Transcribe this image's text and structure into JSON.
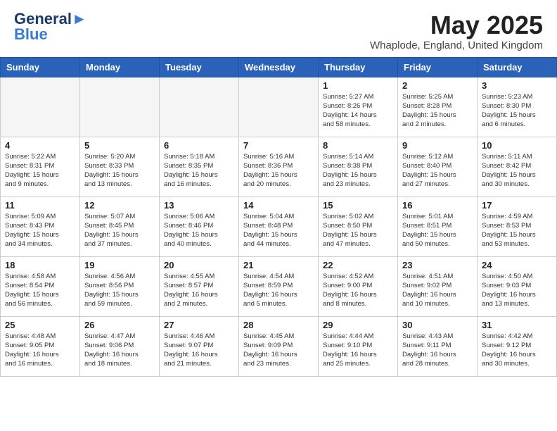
{
  "logo": {
    "general": "General",
    "blue": "Blue"
  },
  "header": {
    "title": "May 2025",
    "subtitle": "Whaplode, England, United Kingdom"
  },
  "days_of_week": [
    "Sunday",
    "Monday",
    "Tuesday",
    "Wednesday",
    "Thursday",
    "Friday",
    "Saturday"
  ],
  "weeks": [
    [
      {
        "day": "",
        "info": ""
      },
      {
        "day": "",
        "info": ""
      },
      {
        "day": "",
        "info": ""
      },
      {
        "day": "",
        "info": ""
      },
      {
        "day": "1",
        "info": "Sunrise: 5:27 AM\nSunset: 8:26 PM\nDaylight: 14 hours\nand 58 minutes."
      },
      {
        "day": "2",
        "info": "Sunrise: 5:25 AM\nSunset: 8:28 PM\nDaylight: 15 hours\nand 2 minutes."
      },
      {
        "day": "3",
        "info": "Sunrise: 5:23 AM\nSunset: 8:30 PM\nDaylight: 15 hours\nand 6 minutes."
      }
    ],
    [
      {
        "day": "4",
        "info": "Sunrise: 5:22 AM\nSunset: 8:31 PM\nDaylight: 15 hours\nand 9 minutes."
      },
      {
        "day": "5",
        "info": "Sunrise: 5:20 AM\nSunset: 8:33 PM\nDaylight: 15 hours\nand 13 minutes."
      },
      {
        "day": "6",
        "info": "Sunrise: 5:18 AM\nSunset: 8:35 PM\nDaylight: 15 hours\nand 16 minutes."
      },
      {
        "day": "7",
        "info": "Sunrise: 5:16 AM\nSunset: 8:36 PM\nDaylight: 15 hours\nand 20 minutes."
      },
      {
        "day": "8",
        "info": "Sunrise: 5:14 AM\nSunset: 8:38 PM\nDaylight: 15 hours\nand 23 minutes."
      },
      {
        "day": "9",
        "info": "Sunrise: 5:12 AM\nSunset: 8:40 PM\nDaylight: 15 hours\nand 27 minutes."
      },
      {
        "day": "10",
        "info": "Sunrise: 5:11 AM\nSunset: 8:42 PM\nDaylight: 15 hours\nand 30 minutes."
      }
    ],
    [
      {
        "day": "11",
        "info": "Sunrise: 5:09 AM\nSunset: 8:43 PM\nDaylight: 15 hours\nand 34 minutes."
      },
      {
        "day": "12",
        "info": "Sunrise: 5:07 AM\nSunset: 8:45 PM\nDaylight: 15 hours\nand 37 minutes."
      },
      {
        "day": "13",
        "info": "Sunrise: 5:06 AM\nSunset: 8:46 PM\nDaylight: 15 hours\nand 40 minutes."
      },
      {
        "day": "14",
        "info": "Sunrise: 5:04 AM\nSunset: 8:48 PM\nDaylight: 15 hours\nand 44 minutes."
      },
      {
        "day": "15",
        "info": "Sunrise: 5:02 AM\nSunset: 8:50 PM\nDaylight: 15 hours\nand 47 minutes."
      },
      {
        "day": "16",
        "info": "Sunrise: 5:01 AM\nSunset: 8:51 PM\nDaylight: 15 hours\nand 50 minutes."
      },
      {
        "day": "17",
        "info": "Sunrise: 4:59 AM\nSunset: 8:53 PM\nDaylight: 15 hours\nand 53 minutes."
      }
    ],
    [
      {
        "day": "18",
        "info": "Sunrise: 4:58 AM\nSunset: 8:54 PM\nDaylight: 15 hours\nand 56 minutes."
      },
      {
        "day": "19",
        "info": "Sunrise: 4:56 AM\nSunset: 8:56 PM\nDaylight: 15 hours\nand 59 minutes."
      },
      {
        "day": "20",
        "info": "Sunrise: 4:55 AM\nSunset: 8:57 PM\nDaylight: 16 hours\nand 2 minutes."
      },
      {
        "day": "21",
        "info": "Sunrise: 4:54 AM\nSunset: 8:59 PM\nDaylight: 16 hours\nand 5 minutes."
      },
      {
        "day": "22",
        "info": "Sunrise: 4:52 AM\nSunset: 9:00 PM\nDaylight: 16 hours\nand 8 minutes."
      },
      {
        "day": "23",
        "info": "Sunrise: 4:51 AM\nSunset: 9:02 PM\nDaylight: 16 hours\nand 10 minutes."
      },
      {
        "day": "24",
        "info": "Sunrise: 4:50 AM\nSunset: 9:03 PM\nDaylight: 16 hours\nand 13 minutes."
      }
    ],
    [
      {
        "day": "25",
        "info": "Sunrise: 4:48 AM\nSunset: 9:05 PM\nDaylight: 16 hours\nand 16 minutes."
      },
      {
        "day": "26",
        "info": "Sunrise: 4:47 AM\nSunset: 9:06 PM\nDaylight: 16 hours\nand 18 minutes."
      },
      {
        "day": "27",
        "info": "Sunrise: 4:46 AM\nSunset: 9:07 PM\nDaylight: 16 hours\nand 21 minutes."
      },
      {
        "day": "28",
        "info": "Sunrise: 4:45 AM\nSunset: 9:09 PM\nDaylight: 16 hours\nand 23 minutes."
      },
      {
        "day": "29",
        "info": "Sunrise: 4:44 AM\nSunset: 9:10 PM\nDaylight: 16 hours\nand 25 minutes."
      },
      {
        "day": "30",
        "info": "Sunrise: 4:43 AM\nSunset: 9:11 PM\nDaylight: 16 hours\nand 28 minutes."
      },
      {
        "day": "31",
        "info": "Sunrise: 4:42 AM\nSunset: 9:12 PM\nDaylight: 16 hours\nand 30 minutes."
      }
    ]
  ]
}
